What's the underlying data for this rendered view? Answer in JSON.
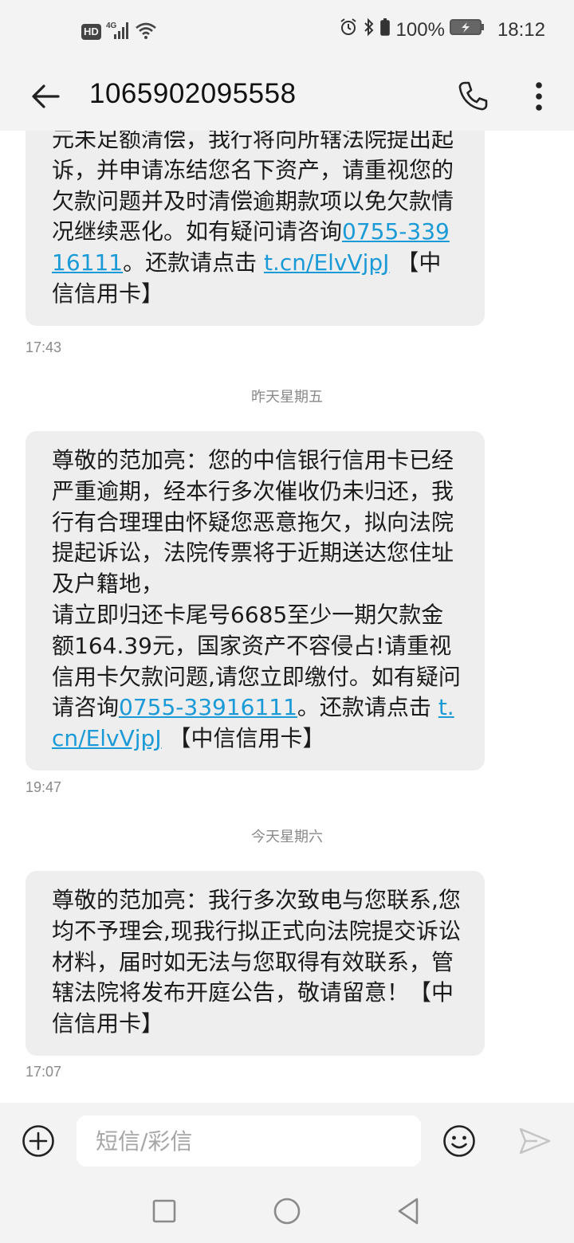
{
  "status_bar": {
    "network_badge": "HD",
    "network_type": "4G",
    "battery": "100%",
    "time": "18:12"
  },
  "header": {
    "contact_number": "1065902095558"
  },
  "messages": [
    {
      "text_1": "元未足额清偿，我行将向所辖法院提出起诉，并申请冻结您名下资产，请重视您的欠款问题并及时清偿逾期款项以免欠款情况继续恶化。如有疑问请咨询",
      "phone_link": "0755-33916111",
      "text_2": "。还款请点击 ",
      "url_link": "t.cn/ElvVjpJ",
      "text_3": " 【中信信用卡】",
      "time": "17:43"
    },
    {
      "date_separator": "昨天星期五",
      "text_1": "尊敬的范加亮：您的中信银行信用卡已经严重逾期，经本行多次催收仍未归还，我行有合理理由怀疑您恶意拖欠，拟向法院提起诉讼，法院传票将于近期送达您住址及户籍地，",
      "text_2": "请立即归还卡尾号6685至少一期欠款金额164.39元，国家资产不容侵占!请重视信用卡欠款问题,请您立即缴付。如有疑问请咨询",
      "phone_link": "0755-33916111",
      "text_3": "。还款请点击 ",
      "url_link": "t.cn/ElvVjpJ",
      "text_4": " 【中信信用卡】",
      "time": "19:47"
    },
    {
      "date_separator": "今天星期六",
      "text": "尊敬的范加亮：我行多次致电与您联系,您均不予理会,现我行拟正式向法院提交诉讼材料，届时如无法与您取得有效联系，管辖法院将发布开庭公告，敬请留意！【中信信用卡】",
      "time": "17:07"
    }
  ],
  "composer": {
    "placeholder": "短信/彩信"
  },
  "icons": {
    "back": "arrow-left-icon",
    "call": "phone-icon",
    "more": "more-vertical-icon",
    "add": "plus-circle-icon",
    "emoji": "smiley-icon",
    "send": "send-icon",
    "alarm": "alarm-icon",
    "bluetooth": "bluetooth-icon",
    "nav_recent": "square-icon",
    "nav_home": "circle-icon",
    "nav_back": "triangle-back-icon"
  },
  "colors": {
    "link": "#1a9ad6",
    "bubble_background": "#eeeeee",
    "bar_background": "#f3f3f3",
    "timestamp": "#8a8a8a"
  }
}
